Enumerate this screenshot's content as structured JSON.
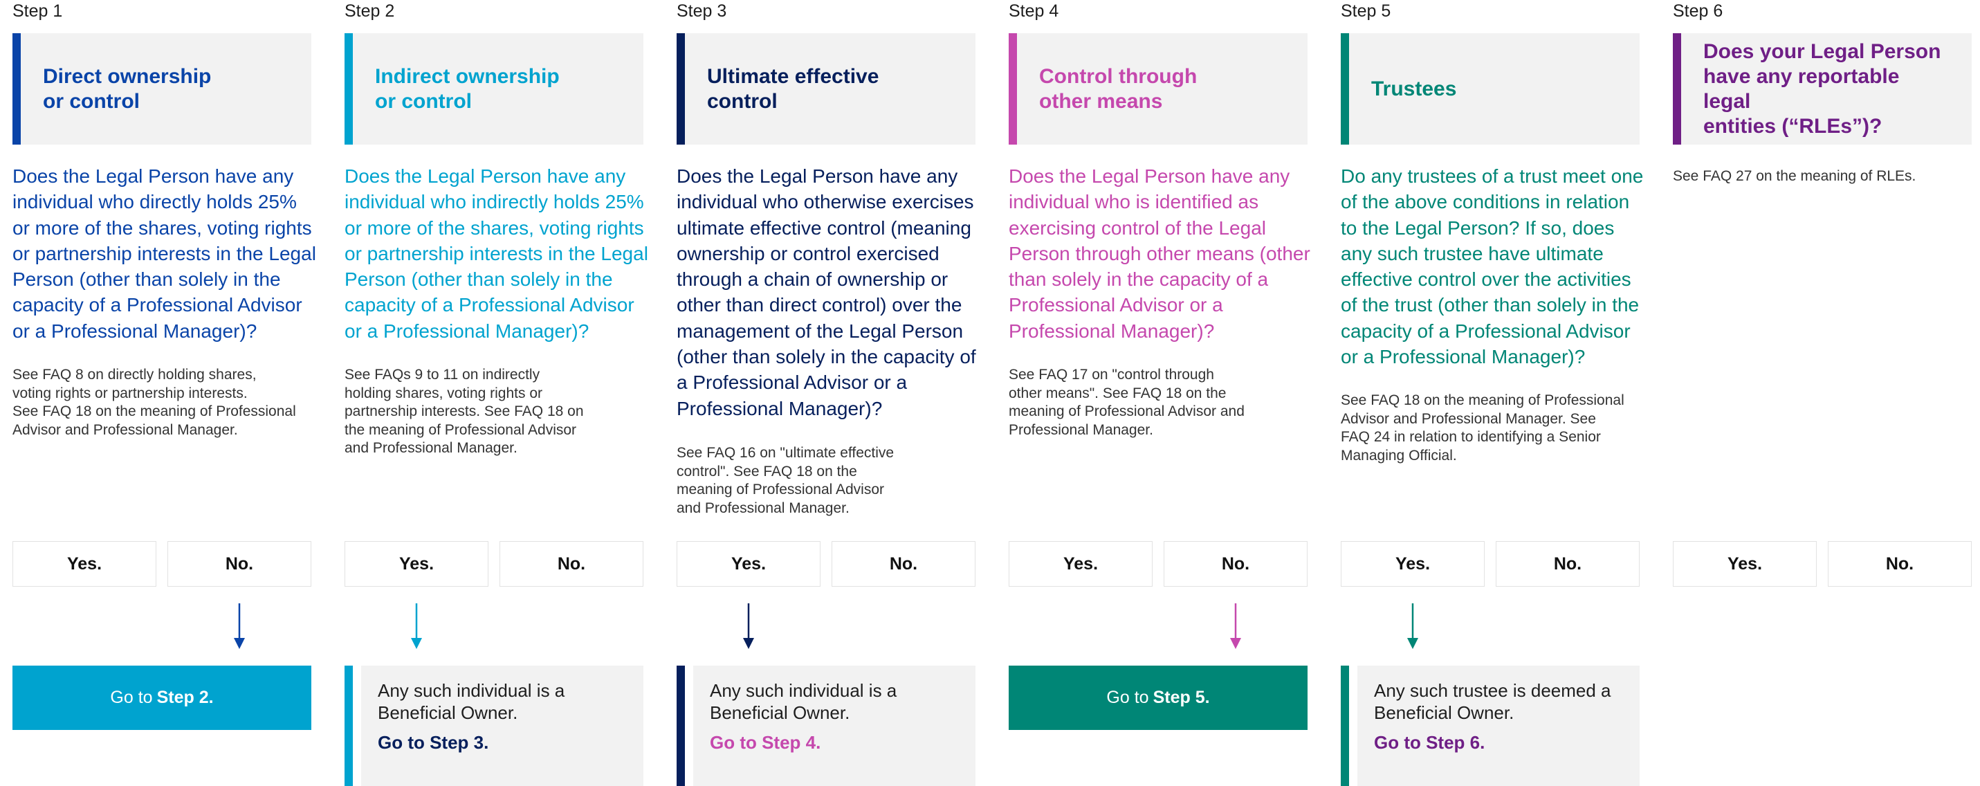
{
  "colors": {
    "step1": "#0a44a8",
    "step2": "#00a3cf",
    "step3": "#061f5c",
    "step4": "#c548ad",
    "step5": "#008676",
    "step6": "#6f1f86"
  },
  "steps": [
    {
      "label": "Step 1",
      "title": "Direct ownership\nor control",
      "question": "Does the Legal Person have any individual who directly holds 25% or more of the shares, voting rights or partnership interests in the Legal Person (other than solely in the capacity of a Professional Advisor or a Professional Manager)?",
      "faq": "See FAQ 8 on directly holding shares,\nvoting rights or partnership interests.\nSee FAQ 18 on the meaning of Professional\nAdvisor and Professional Manager.",
      "yes": "Yes.",
      "no": "No."
    },
    {
      "label": "Step 2",
      "title": "Indirect ownership\nor control",
      "question": "Does the Legal Person have any individual who indirectly holds 25% or more of the shares, voting rights or partnership interests in the Legal Person (other than solely in the capacity of a Professional Advisor or a Professional Manager)?",
      "faq": "See FAQs 9 to 11 on indirectly\nholding shares, voting rights or\npartnership interests. See FAQ 18 on\nthe meaning of Professional Advisor\nand Professional Manager.",
      "yes": "Yes.",
      "no": "No."
    },
    {
      "label": "Step 3",
      "title": "Ultimate effective\ncontrol",
      "question": "Does the Legal Person have any individual who otherwise exercises ultimate effective control (meaning ownership or control exercised through a chain of ownership or other than direct control) over the management of the Legal Person (other than solely in the capacity of a Professional Advisor or a Professional Manager)?",
      "faq": "See FAQ 16 on \"ultimate effective\ncontrol\". See FAQ 18 on the\nmeaning of Professional Advisor\nand Professional  Manager.",
      "yes": "Yes.",
      "no": "No."
    },
    {
      "label": "Step 4",
      "title": "Control through\nother means",
      "question": "Does the Legal Person have any individual who is identified as exercising control of the Legal Person through other means (other than solely in the capacity of a Professional Advisor or a Professional Manager)?",
      "faq": "See FAQ 17 on \"control through\nother means\". See FAQ 18 on the\nmeaning of Professional Advisor and\nProfessional  Manager.",
      "yes": "Yes.",
      "no": "No."
    },
    {
      "label": "Step 5",
      "title": "Trustees",
      "question": "Do any trustees of a trust meet one of the above conditions in relation to the Legal Person? If so, does any such trustee have ultimate effective control over the activities of the trust (other than solely in the capacity of a Professional Advisor or a Professional Manager)?",
      "faq": "See FAQ 18 on the meaning of Professional\nAdvisor and Professional Manager. See\nFAQ 24 in relation to identifying a Senior\nManaging Official.",
      "yes": "Yes.",
      "no": "No."
    },
    {
      "label": "Step 6",
      "title": "Does your Legal Person\nhave any reportable legal\nentities (“RLEs”)?",
      "question": "",
      "faq": "See FAQ 27 on the meaning of RLEs.",
      "yes": "Yes.",
      "no": "No."
    }
  ],
  "outcomes": {
    "step1_no": {
      "prefix": "Go to",
      "target": "Step 2."
    },
    "step2_yes": {
      "text": "Any such individual is a Beneficial Owner.",
      "goto": "Go to Step 3."
    },
    "step3_yes": {
      "text": "Any such individual is a Beneficial Owner.",
      "goto": "Go to Step 4."
    },
    "step4_no": {
      "prefix": "Go to",
      "target": "Step 5."
    },
    "step5_yes": {
      "text": "Any such trustee is deemed a Beneficial Owner.",
      "goto": "Go to Step 6."
    }
  }
}
